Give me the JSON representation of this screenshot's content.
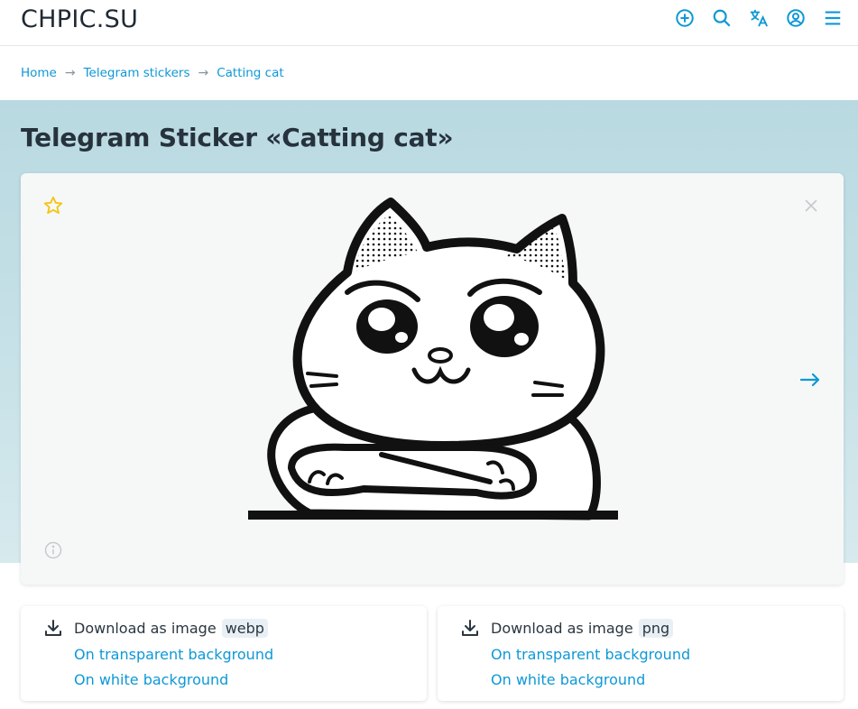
{
  "header": {
    "logo": "CHPIC.SU",
    "icons": [
      "add-icon",
      "search-icon",
      "translate-icon",
      "account-icon",
      "menu-icon"
    ],
    "accent": "#0e98d6"
  },
  "breadcrumb": {
    "items": [
      "Home",
      "Telegram stickers",
      "Catting cat"
    ],
    "separator": "→"
  },
  "page": {
    "title": "Telegram Sticker «Catting cat»"
  },
  "viewer": {
    "next_arrow": "→",
    "star_color": "#f5c518"
  },
  "downloads": [
    {
      "label": "Download as image",
      "format": "webp",
      "links": [
        "On transparent background",
        "On white background"
      ]
    },
    {
      "label": "Download as image",
      "format": "png",
      "links": [
        "On transparent background",
        "On white background"
      ]
    }
  ]
}
